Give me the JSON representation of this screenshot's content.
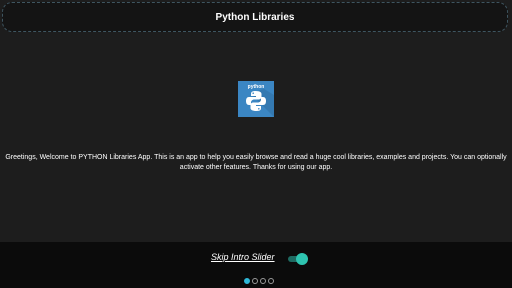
{
  "header": {
    "title": "Python Libraries"
  },
  "logo": {
    "text": "python",
    "icon": "python-logo-icon",
    "background_color": "#3b86c3"
  },
  "intro": {
    "line1": "Greetings, Welcome to PYTHON Libraries App. This is an app to help you easily browse and read a huge cool libraries, examples and projects. You can optionally",
    "line2": "activate other features. Thanks for using our app."
  },
  "footer": {
    "skip_label": "Skip Intro Slider",
    "toggle_on": true,
    "toggle_color": "#2ec4b0",
    "pager": {
      "total": 4,
      "current": 1,
      "active_color": "#2eb8d8"
    }
  }
}
